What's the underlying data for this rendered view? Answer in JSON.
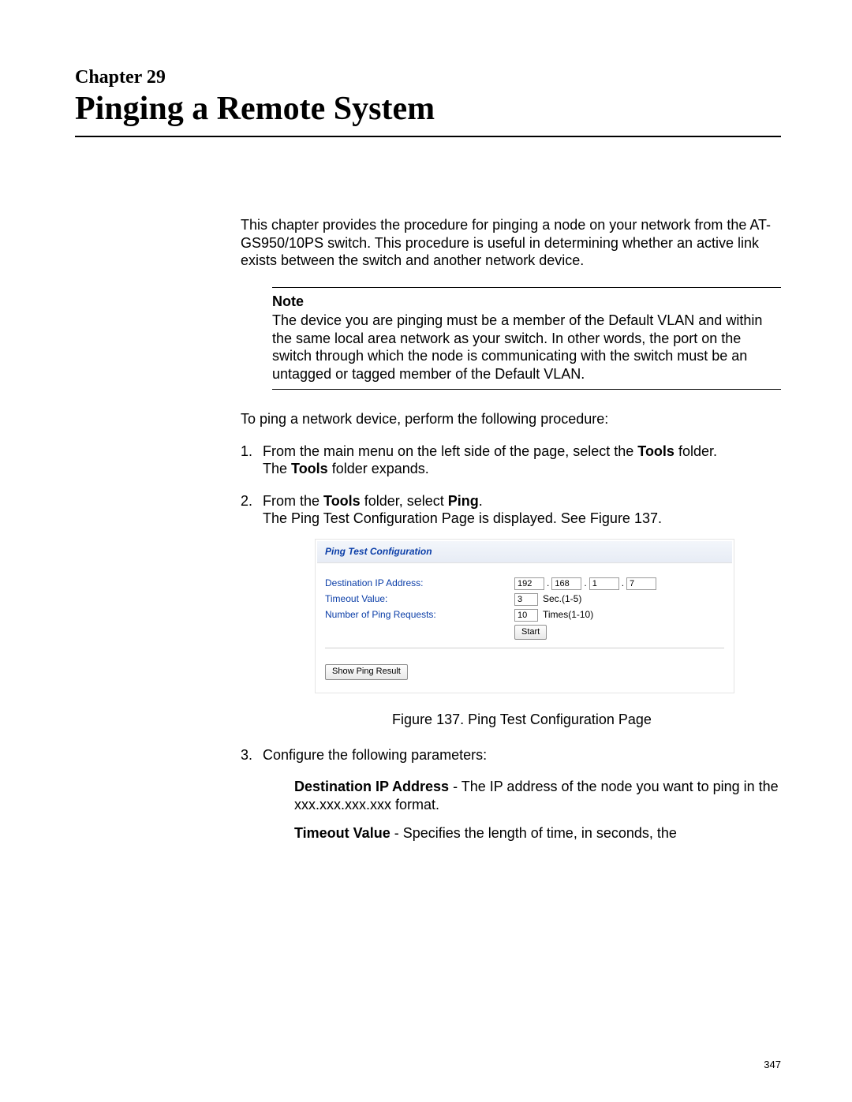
{
  "chapter_label": "Chapter 29",
  "title": "Pinging a Remote System",
  "intro": "This chapter provides the procedure for pinging a node on your network from the AT-GS950/10PS switch. This procedure is useful in determining whether an active link exists between the switch and another network device.",
  "note": {
    "heading": "Note",
    "body": "The device you are pinging must be a member of the Default VLAN and within the same local area network as your switch. In other words, the port on the switch through which the node is communicating with the switch must be an untagged or tagged member of the Default VLAN."
  },
  "lead": "To ping a network device, perform the following procedure:",
  "steps": {
    "s1": {
      "l1a": "From the main menu on the left side of the page, select the ",
      "l1b": "Tools",
      "l1c": " folder.",
      "l2a": "The ",
      "l2b": "Tools",
      "l2c": " folder expands."
    },
    "s2": {
      "l1a": "From the ",
      "l1b": "Tools",
      "l1c": " folder, select ",
      "l1d": "Ping",
      "l1e": ".",
      "l2": "The Ping Test Configuration Page is displayed. See Figure 137."
    },
    "s3": {
      "l1": "Configure the following parameters:",
      "p1_label": "Destination IP Address",
      "p1_text": " - The IP address of the node you want to ping in the xxx.xxx.xxx.xxx format.",
      "p2_label": "Timeout Value",
      "p2_text": " - Specifies the length of time, in seconds, the"
    }
  },
  "figure": {
    "header": "Ping Test Configuration",
    "dest_label": "Destination IP Address:",
    "timeout_label": "Timeout Value:",
    "requests_label": "Number of Ping Requests:",
    "ip": {
      "a": "192",
      "b": "168",
      "c": "1",
      "d": "7"
    },
    "timeout_value": "3",
    "timeout_suffix": "Sec.(1-5)",
    "requests_value": "10",
    "requests_suffix": "Times(1-10)",
    "start_btn": "Start",
    "show_btn": "Show Ping Result",
    "caption": "Figure 137. Ping Test Configuration Page"
  },
  "page_number": "347"
}
